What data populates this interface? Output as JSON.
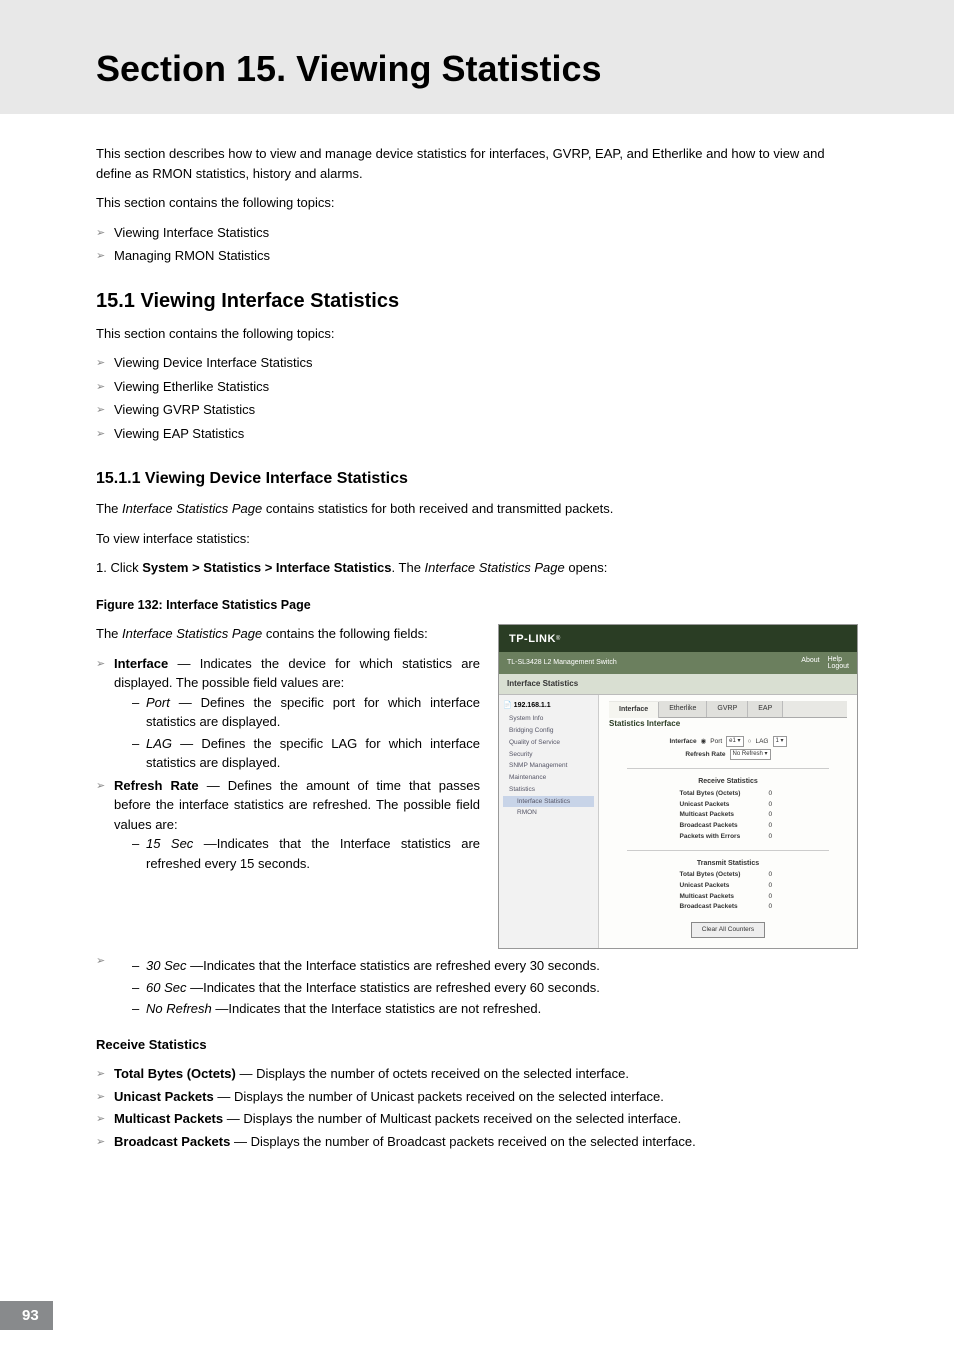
{
  "header": {
    "title": "Section 15.  Viewing Statistics"
  },
  "intro": {
    "p1": "This section describes how to view and manage device statistics for interfaces, GVRP, EAP, and Etherlike and how to view and define as RMON statistics, history and alarms.",
    "p2": "This section contains the following topics:",
    "items": [
      "Viewing Interface Statistics",
      "Managing RMON Statistics"
    ]
  },
  "s15_1": {
    "title": "15.1  Viewing Interface Statistics",
    "p1": "This section contains the following topics:",
    "items": [
      "Viewing Device Interface Statistics",
      "Viewing Etherlike Statistics",
      "Viewing GVRP Statistics",
      "Viewing EAP Statistics"
    ]
  },
  "s15_1_1": {
    "title": "15.1.1  Viewing Device Interface Statistics",
    "p1a": "The ",
    "p1b": "Interface Statistics Page",
    "p1c": " contains statistics for both received and transmitted packets.",
    "p2": "To view interface statistics:",
    "step_pre": "1.  Click ",
    "step_bold": "System > Statistics > Interface Statistics",
    "step_mid": ". The ",
    "step_ital": "Interface Statistics Page",
    "step_post": " opens:",
    "fig": "Figure 132: Interface Statistics Page",
    "fields_intro_a": "The ",
    "fields_intro_b": "Interface Statistics Page",
    "fields_intro_c": " contains the following fields:",
    "f_interface_b": "Interface",
    "f_interface_t": " — Indicates the device for which statistics are displayed. The possible field values are:",
    "f_port_i": "Port",
    "f_port_t": " — Defines the specific port for which interface statistics are displayed.",
    "f_lag_i": "LAG",
    "f_lag_t": " — Defines the specific LAG for which interface statistics are displayed.",
    "f_refresh_b": "Refresh Rate",
    "f_refresh_t": " — Defines the amount of time that passes before the interface statistics are refreshed. The possible field values are:",
    "f_15_i": "15 Sec ",
    "f_15_t": "—Indicates that the Interface statistics are refreshed every 15 seconds.",
    "f_30_i": "30 Sec ",
    "f_30_t": "—Indicates that the Interface statistics are refreshed every 30 seconds.",
    "f_60_i": "60 Sec ",
    "f_60_t": "—Indicates that the Interface statistics are refreshed every 60 seconds.",
    "f_nr_i": "No Refresh ",
    "f_nr_t": "—Indicates that the Interface statistics are not refreshed.",
    "recv_h": "Receive Statistics",
    "r1_b": "Total Bytes (Octets)",
    "r1_t": " — Displays the number of octets received on the selected interface.",
    "r2_b": "Unicast Packets",
    "r2_t": " — Displays the number of Unicast packets received on the selected interface.",
    "r3_b": "Multicast Packets",
    "r3_t": " — Displays the number of Multicast packets received on the selected interface.",
    "r4_b": "Broadcast Packets",
    "r4_t": " — Displays the number of Broadcast packets received on the selected interface."
  },
  "shot": {
    "logo": "TP-LINK",
    "device": "TL-SL3428 L2 Management Switch",
    "about": "About",
    "help": "Help",
    "logout": "Logout",
    "breadcrumb": "Interface Statistics",
    "tabs": [
      "Interface",
      "Etherlike",
      "GVRP",
      "EAP"
    ],
    "body_h": "Statistics Interface",
    "lbl_interface": "Interface",
    "opt_port": "Port",
    "opt_port_v": "e1",
    "opt_lag": "LAG",
    "opt_lag_v": "1",
    "lbl_refresh": "Refresh Rate",
    "val_refresh": "No Refresh",
    "recv_title": "Receive Statistics",
    "send_title": "Transmit Statistics",
    "stats_recv": [
      {
        "k": "Total Bytes (Octets)",
        "v": "0"
      },
      {
        "k": "Unicast Packets",
        "v": "0"
      },
      {
        "k": "Multicast Packets",
        "v": "0"
      },
      {
        "k": "Broadcast Packets",
        "v": "0"
      },
      {
        "k": "Packets with Errors",
        "v": "0"
      }
    ],
    "stats_send": [
      {
        "k": "Total Bytes (Octets)",
        "v": "0"
      },
      {
        "k": "Unicast Packets",
        "v": "0"
      },
      {
        "k": "Multicast Packets",
        "v": "0"
      },
      {
        "k": "Broadcast Packets",
        "v": "0"
      }
    ],
    "btn": "Clear All Counters",
    "tree_root": "192.168.1.1",
    "tree": [
      "System Info",
      "Bridging Config",
      "Quality of Service",
      "Security",
      "SNMP Management",
      "Maintenance",
      "Statistics"
    ],
    "tree_sub": "Interface Statistics",
    "tree_last": "RMON"
  },
  "page": "93"
}
